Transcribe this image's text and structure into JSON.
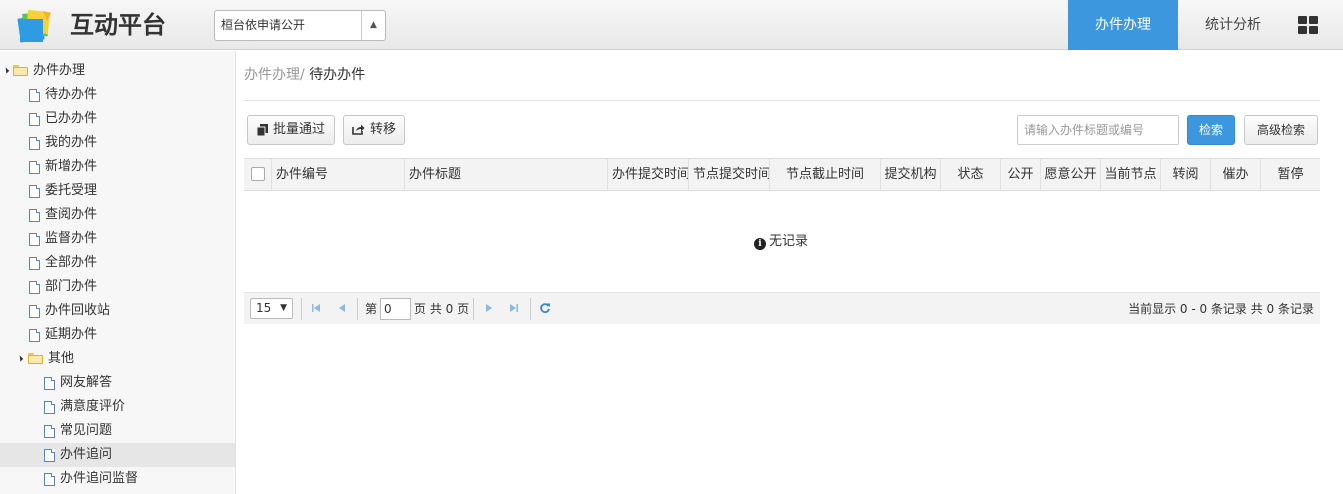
{
  "header": {
    "app_title": "互动平台",
    "site_select_value": "桓台依申请公开",
    "nav": [
      {
        "label": "办件办理",
        "active": true
      },
      {
        "label": "统计分析",
        "active": false
      }
    ]
  },
  "sidebar": {
    "root": {
      "label": "办件办理"
    },
    "items": [
      "待办办件",
      "已办办件",
      "我的办件",
      "新增办件",
      "委托受理",
      "查阅办件",
      "监督办件",
      "全部办件",
      "部门办件",
      "办件回收站",
      "延期办件"
    ],
    "other": {
      "label": "其他"
    },
    "other_items": [
      "网友解答",
      "满意度评价",
      "常见问题",
      "办件追问",
      "办件追问监督"
    ],
    "selected": "办件追问"
  },
  "breadcrumb": {
    "parent": "办件办理/",
    "current": "待办办件"
  },
  "toolbar": {
    "batch_pass_label": "批量通过",
    "transfer_label": "转移",
    "search_placeholder": "请输入办件标题或编号",
    "search_label": "检索",
    "advanced_search_label": "高级检索"
  },
  "table": {
    "columns": [
      "办件编号",
      "办件标题",
      "办件提交时间",
      "节点提交时间",
      "节点截止时间",
      "提交机构",
      "状态",
      "公开",
      "愿意公开",
      "当前节点",
      "转阅",
      "催办",
      "暂停"
    ],
    "empty_text": "无记录"
  },
  "pager": {
    "page_size": "15",
    "page_prefix": "第",
    "page_value": "0",
    "page_suffix": "页 共 0 页",
    "info": "当前显示 0 - 0 条记录 共 0 条记录"
  },
  "colors": {
    "accent": "#3c97df"
  }
}
